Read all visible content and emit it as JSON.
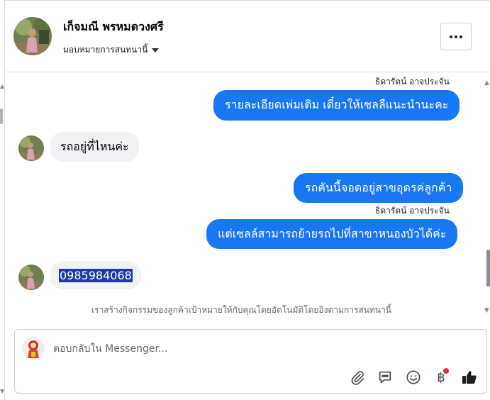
{
  "header": {
    "contact_name": "เก็จมณี พรหมดวงศรี",
    "assign_label": "มอบหมายการสนทนานี้"
  },
  "messages": [
    {
      "direction": "outgoing",
      "sender": "ธิดารัตน์ อาจประจัน",
      "text": "รายละเอียดเพ่มเติม เดี๋ยวให้เซลลืแนะนำนะคะ"
    },
    {
      "direction": "incoming",
      "text": "รถอยู่ที่ไหนค่ะ"
    },
    {
      "direction": "outgoing",
      "text": "รถคันนี้จอดอยู่สาขอุดรค่ลูกค้า"
    },
    {
      "direction": "outgoing",
      "sender": "ธิดารัตน์ อาจประจัน",
      "text": "แต่เซลล์สามารถย้ายรถไปที่สาขาหนองบัวได้ค่ะ"
    },
    {
      "direction": "incoming",
      "text": "0985984068",
      "selected": true
    }
  ],
  "notice": "เราสร้างกิจกรรมของลูกค้าเป้าหมายให้กับคุณโดยอัตโนมัติโดยอิงตามการสนทนานี้",
  "composer": {
    "placeholder": "ตอบกลับใน Messenger...",
    "value": "",
    "tools": [
      "paperclip-icon",
      "chat-bubble-icon",
      "emoji-icon",
      "baht-payment-icon",
      "thumbs-up-icon"
    ],
    "baht_symbol": "฿"
  },
  "colors": {
    "outgoing_bubble": "#1877f2",
    "incoming_bubble": "#f0f2f5",
    "selection": "#1f3aa6",
    "notification_dot": "#f02849"
  }
}
